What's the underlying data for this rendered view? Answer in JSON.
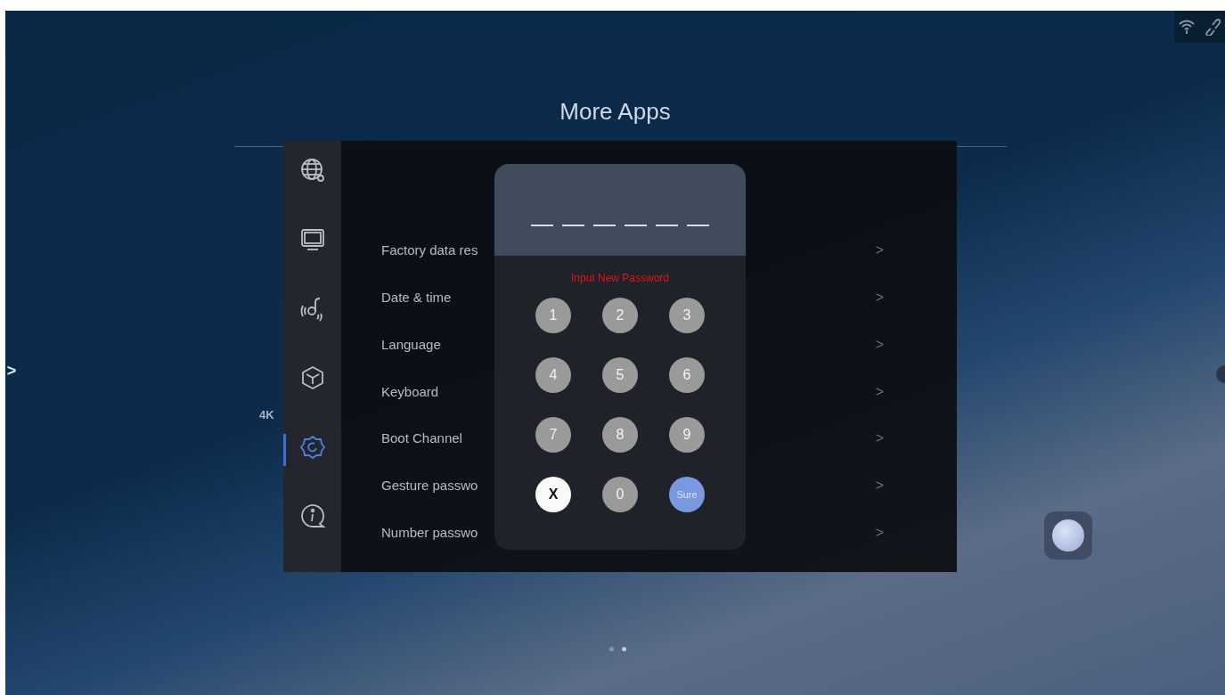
{
  "page_title": "More Apps",
  "desktop_labels": [
    "4K"
  ],
  "sidebar": {
    "items": [
      {
        "selected": false
      },
      {
        "selected": false
      },
      {
        "selected": false
      },
      {
        "selected": false
      },
      {
        "selected": true
      },
      {
        "selected": false
      }
    ]
  },
  "settings_rows": [
    {
      "label": "Factory data res",
      "chevron": ">"
    },
    {
      "label": "Date & time",
      "chevron": ">"
    },
    {
      "label": "Language",
      "chevron": ">"
    },
    {
      "label": "Keyboard",
      "chevron": ">"
    },
    {
      "label": "Boot Channel",
      "chevron": ">"
    },
    {
      "label": "Gesture passwo",
      "chevron": ">"
    },
    {
      "label": "Number passwo",
      "chevron": ">"
    }
  ],
  "password_dialog": {
    "slots": [
      {
        "filled": false
      },
      {
        "filled": false
      },
      {
        "filled": false
      },
      {
        "filled": false
      },
      {
        "filled": false
      },
      {
        "filled": false
      }
    ],
    "prompt": "Input New Password",
    "keys": [
      {
        "label": "1",
        "kind": "digit"
      },
      {
        "label": "2",
        "kind": "digit"
      },
      {
        "label": "3",
        "kind": "digit"
      },
      {
        "label": "4",
        "kind": "digit"
      },
      {
        "label": "5",
        "kind": "digit"
      },
      {
        "label": "6",
        "kind": "digit"
      },
      {
        "label": "7",
        "kind": "digit"
      },
      {
        "label": "8",
        "kind": "digit"
      },
      {
        "label": "9",
        "kind": "digit"
      },
      {
        "label": "X",
        "kind": "clear"
      },
      {
        "label": "0",
        "kind": "digit"
      },
      {
        "label": "Sure",
        "kind": "confirm"
      }
    ]
  },
  "left_arrow": ">",
  "page_dots": [
    {
      "selected": false
    },
    {
      "selected": true
    }
  ]
}
